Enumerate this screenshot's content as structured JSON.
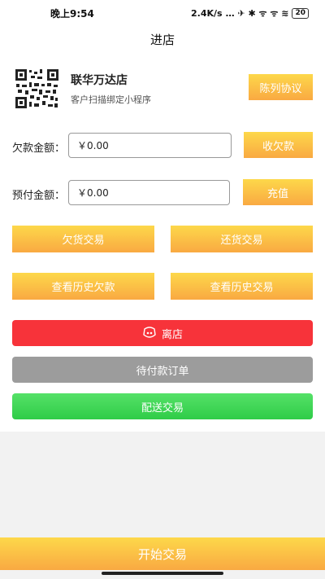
{
  "status_bar": {
    "time": "晚上9:54",
    "network_speed": "2.4K/s",
    "indicators": "… ✈ ✱ ᯤ ᯤ ≋",
    "battery": "20"
  },
  "header": {
    "title": "进店"
  },
  "store": {
    "name": "联华万达店",
    "subtitle": "客户扫描绑定小程序",
    "display_agreement_label": "陈列协议"
  },
  "debt": {
    "label": "欠款金额：",
    "value": "￥0.00",
    "button_label": "收欠款"
  },
  "prepaid": {
    "label": "预付金额：",
    "value": "￥0.00",
    "button_label": "充值"
  },
  "actions": {
    "owe_goods_label": "欠货交易",
    "return_goods_label": "还货交易",
    "history_debt_label": "查看历史欠款",
    "history_trade_label": "查看历史交易"
  },
  "leave": {
    "label": "离店",
    "icon": "exit-store-icon"
  },
  "pending_orders_label": "待付款订单",
  "delivery_label": "配送交易",
  "start_trade_label": "开始交易",
  "colors": {
    "accent_top": "#fdd84a",
    "accent_bottom": "#f9a942",
    "red": "#f7333a",
    "gray": "#9c9c9c",
    "green": "#2fcc48"
  }
}
